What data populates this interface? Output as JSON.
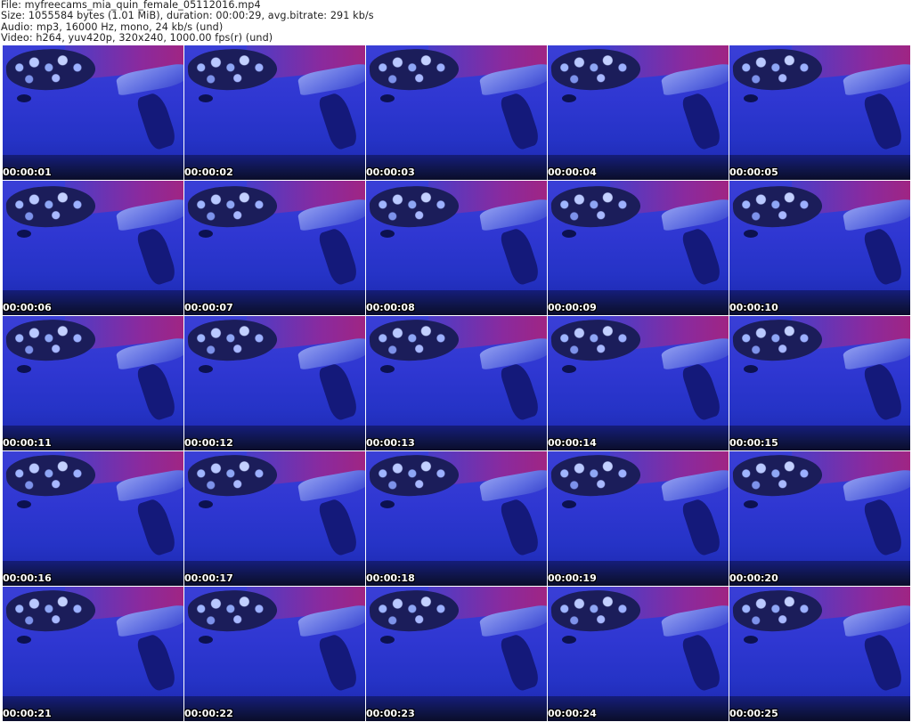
{
  "header": {
    "file_line": "File: myfreecams_mia_quin_female_05112016.mp4",
    "size_line": "Size: 1055584 bytes (1.01 MiB), duration: 00:00:29, avg.bitrate: 291 kb/s",
    "audio_line": "Audio: mp3, 16000 Hz, mono, 24 kb/s (und)",
    "video_line": "Video: h264, yuv420p, 320x240, 1000.00 fps(r) (und)"
  },
  "thumbnails": [
    {
      "timestamp": "00:00:01"
    },
    {
      "timestamp": "00:00:02"
    },
    {
      "timestamp": "00:00:03"
    },
    {
      "timestamp": "00:00:04"
    },
    {
      "timestamp": "00:00:05"
    },
    {
      "timestamp": "00:00:06"
    },
    {
      "timestamp": "00:00:07"
    },
    {
      "timestamp": "00:00:08"
    },
    {
      "timestamp": "00:00:09"
    },
    {
      "timestamp": "00:00:10"
    },
    {
      "timestamp": "00:00:11"
    },
    {
      "timestamp": "00:00:12"
    },
    {
      "timestamp": "00:00:13"
    },
    {
      "timestamp": "00:00:14"
    },
    {
      "timestamp": "00:00:15"
    },
    {
      "timestamp": "00:00:16"
    },
    {
      "timestamp": "00:00:17"
    },
    {
      "timestamp": "00:00:18"
    },
    {
      "timestamp": "00:00:19"
    },
    {
      "timestamp": "00:00:20"
    },
    {
      "timestamp": "00:00:21"
    },
    {
      "timestamp": "00:00:22"
    },
    {
      "timestamp": "00:00:23"
    },
    {
      "timestamp": "00:00:24"
    },
    {
      "timestamp": "00:00:25"
    }
  ],
  "colors": {
    "background": "#ffffff",
    "header_text": "#222222",
    "timestamp_text": "#ffffff",
    "frame_dominant": "#2533c6"
  }
}
